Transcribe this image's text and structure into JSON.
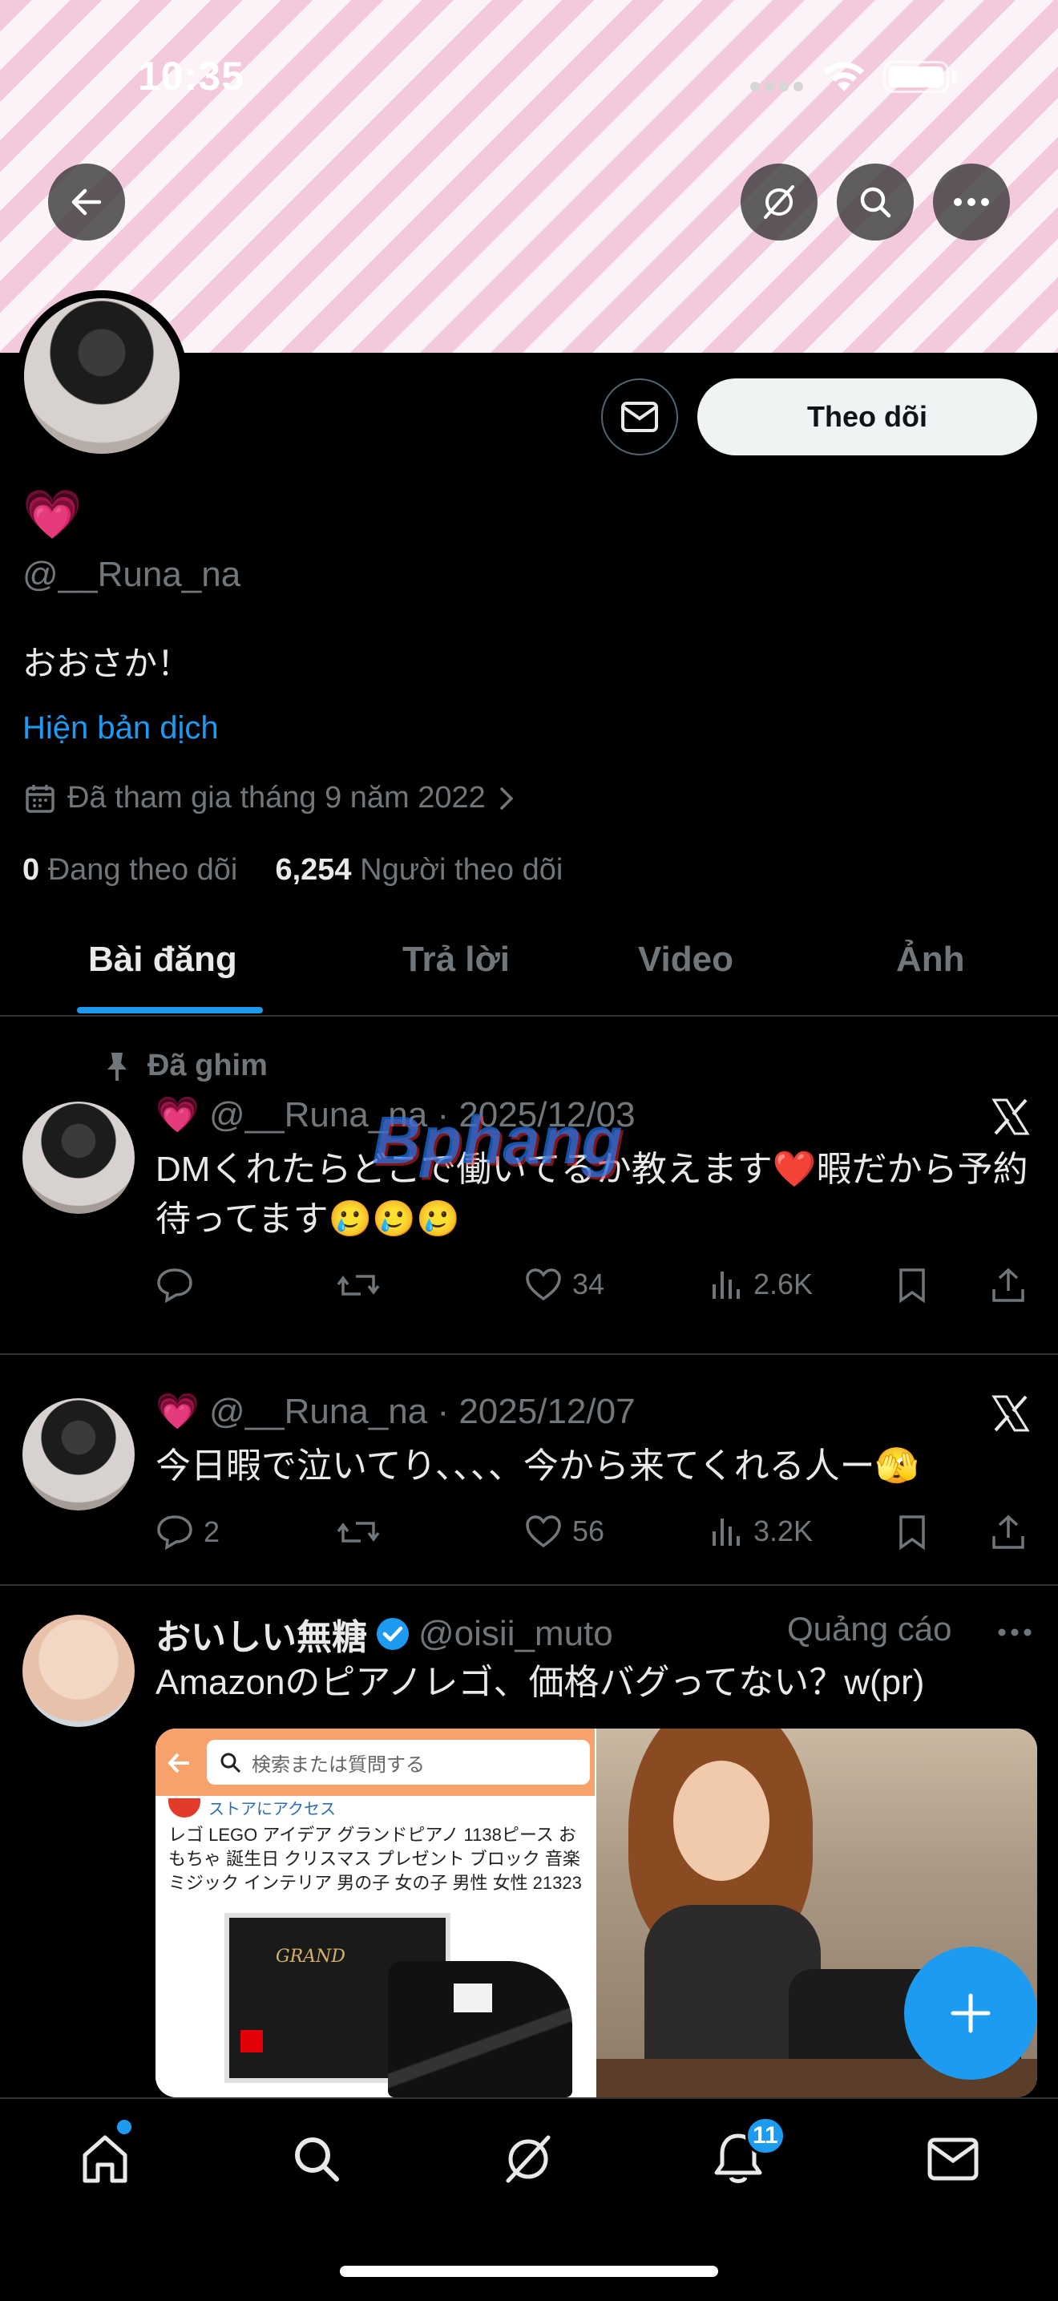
{
  "status_bar": {
    "time": "10:35"
  },
  "profile": {
    "emoji": "💗",
    "handle": "@__Runa_na",
    "bio": "おおさか！",
    "translate_link": "Hiện bản dịch",
    "joined": "Đã tham gia tháng 9 năm 2022",
    "following_count": "0",
    "following_label": "Đang theo dõi",
    "followers_count": "6,254",
    "followers_label": "Người theo dõi",
    "follow_button": "Theo dõi"
  },
  "tabs": [
    "Bài đăng",
    "Trả lời",
    "Video",
    "Ảnh"
  ],
  "posts": [
    {
      "pinned_label": "Đã ghim",
      "emoji": "💗",
      "meta": "@__Runa_na · 2025/12/03",
      "text": "DMくれたらどこで働いてるか教えます❤️暇だから予約待ってます🥲🥲🥲",
      "replies": "",
      "reposts": "",
      "likes": "34",
      "views": "2.6K"
    },
    {
      "emoji": "💗",
      "meta": "@__Runa_na · 2025/12/07",
      "text": "今日暇で泣いてり、、、、今から来てくれる人ー🫣",
      "replies": "2",
      "reposts": "",
      "likes": "56",
      "views": "3.2K"
    }
  ],
  "ad": {
    "name": "おいしい無糖",
    "handle": "@oisii_muto",
    "label": "Quảng cáo",
    "text": "Amazonのピアノレゴ、価格バグってない？w(pr)",
    "search_placeholder": "検索または質問する",
    "store_visit": "ストアにアクセス",
    "product_title": "レゴ LEGO アイデア グランドピアノ 1138ピース おもちゃ 誕生日 クリスマス プレゼント ブロック 音楽 ミジック インテリア 男の子 女の子 男性 女性 21323",
    "box_text": "GRAND"
  },
  "watermark": "Bphang",
  "notifications_badge": "11",
  "colors": {
    "accent": "#1d9bf0",
    "muted": "#71767b",
    "background": "#000000"
  }
}
